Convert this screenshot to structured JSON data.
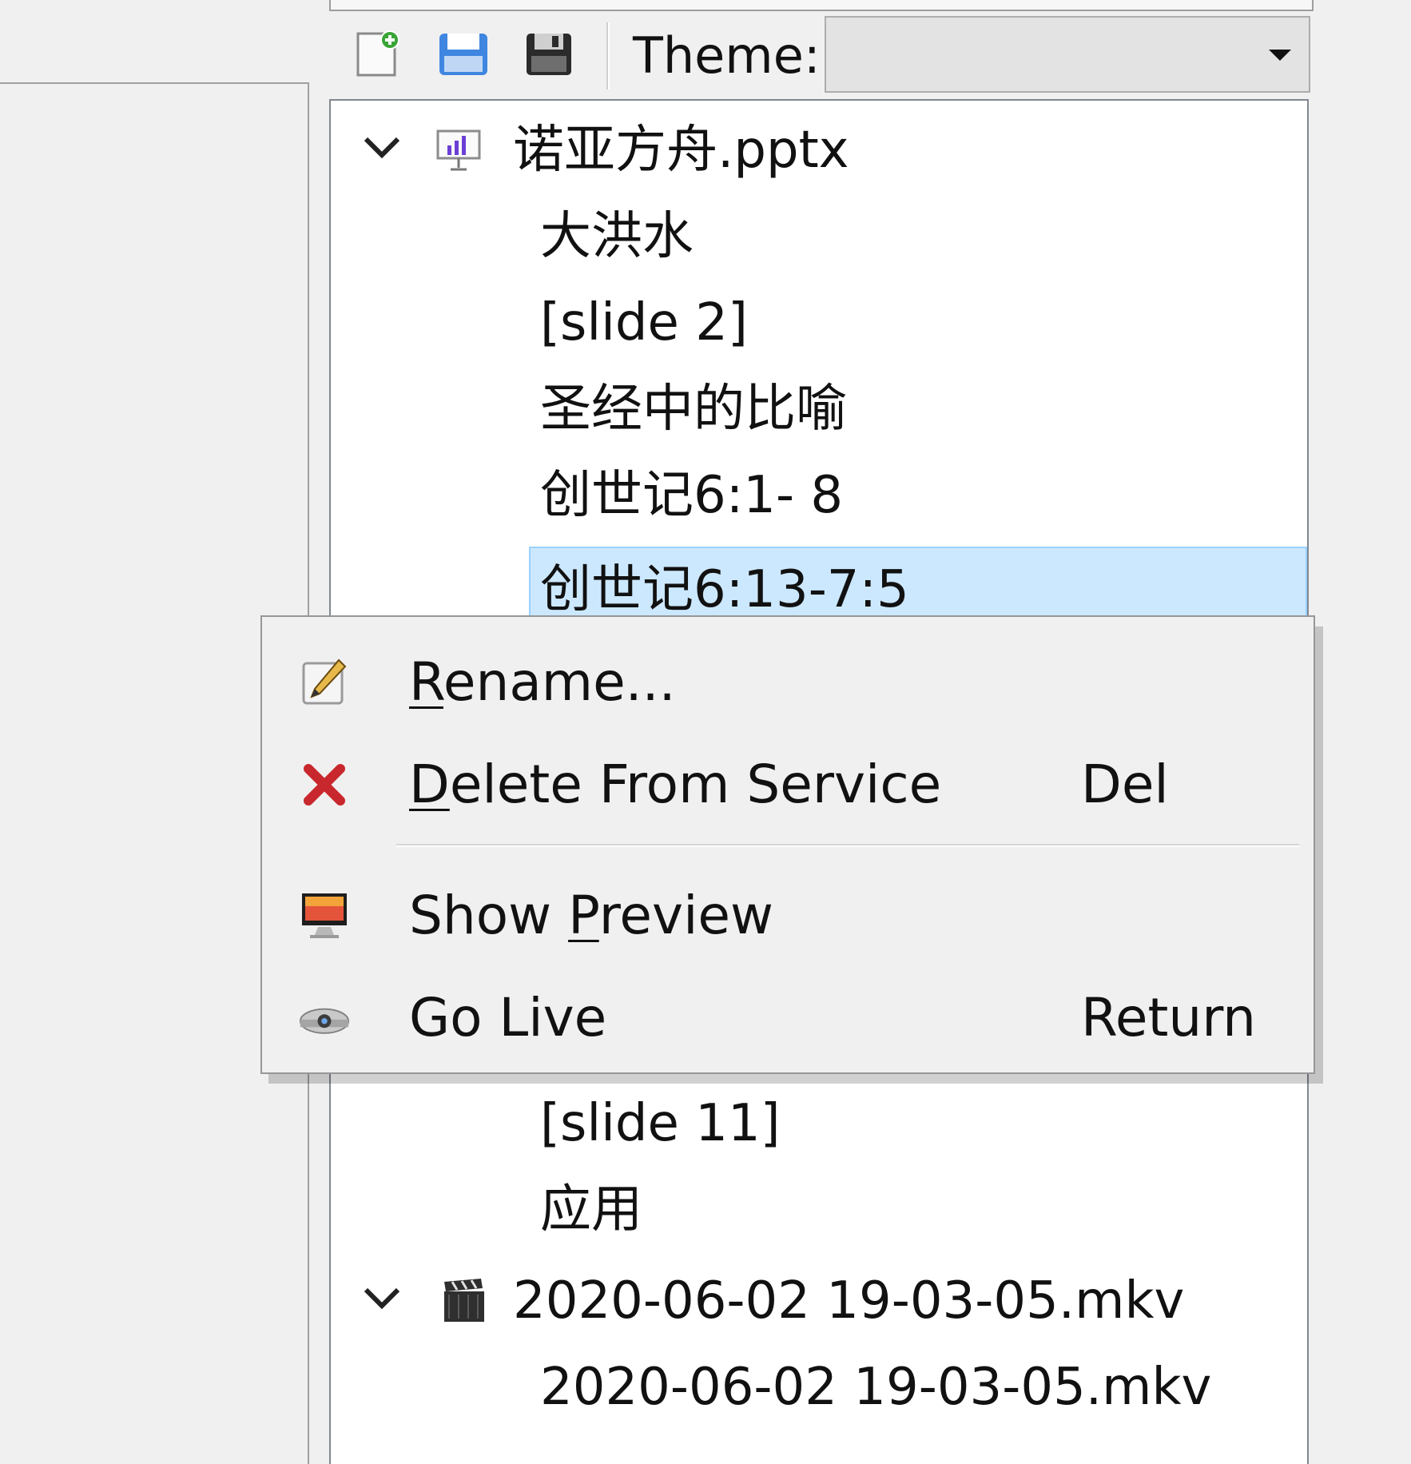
{
  "toolbar": {
    "new_label": "New Service",
    "open_label": "Open Service",
    "save_label": "Save Service",
    "theme_label": "Theme:",
    "theme_value": ""
  },
  "tree": {
    "items": [
      {
        "label": "诺亚方舟.pptx",
        "type": "presentation",
        "expanded": true,
        "children": [
          "大洪水",
          "[slide 2]",
          "圣经中的比喻",
          "创世记6:1- 8",
          "创世记6:13-7:5",
          "[slide 11]",
          "应用"
        ]
      },
      {
        "label": "2020-06-02 19-03-05.mkv",
        "type": "media",
        "expanded": true,
        "children": [
          "2020-06-02 19-03-05.mkv"
        ]
      }
    ],
    "row0": "诺亚方舟.pptx",
    "row1": "大洪水",
    "row2": "[slide 2]",
    "row3": "圣经中的比喻",
    "row4": "创世记6:1- 8",
    "row5": "创世记6:13-7:5",
    "row6": "[slide 11]",
    "row7": "应用",
    "row8": "2020-06-02 19-03-05.mkv",
    "row9": "2020-06-02 19-03-05.mkv",
    "selected": "创世记6:13-7:5"
  },
  "context_menu": {
    "rename": {
      "pre": "",
      "mn": "R",
      "post": "ename..."
    },
    "delete": {
      "pre": "",
      "mn": "D",
      "post": "elete From Service",
      "shortcut": "Del"
    },
    "preview": {
      "pre": "Show ",
      "mn": "P",
      "post": "review"
    },
    "live": {
      "label": "Go Live",
      "shortcut": "Return"
    }
  },
  "icons": {
    "new": "new-service-icon",
    "open": "open-service-icon",
    "save": "save-service-icon",
    "presentation": "presentation-icon",
    "media": "video-clapper-icon",
    "rename": "pencil-edit-icon",
    "delete": "red-x-delete-icon",
    "preview": "monitor-preview-icon",
    "live": "projector-live-icon"
  },
  "colors": {
    "selection_bg": "#cce8ff",
    "selection_border": "#99d1ff",
    "delete_red": "#c8282d"
  }
}
